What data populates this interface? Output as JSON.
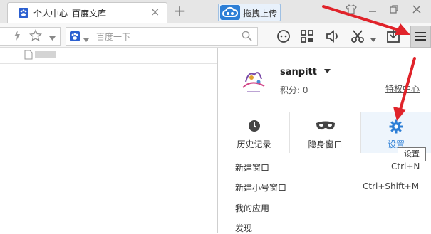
{
  "tabs": [
    {
      "title": "个人中心_百度文库",
      "close_label": "×",
      "favicon": "paw-icon"
    }
  ],
  "new_tab_label": "+",
  "toolbar": {
    "upload_label": "拖拽上传",
    "search_placeholder": "百度一下"
  },
  "menu": {
    "username": "sanpitt",
    "points": "积分: 0",
    "vip_link": "特权中心",
    "tiles": [
      {
        "label": "历史记录",
        "icon": "clock-icon"
      },
      {
        "label": "隐身窗口",
        "icon": "mask-icon"
      },
      {
        "label": "设置",
        "icon": "gear-icon"
      }
    ],
    "items": [
      {
        "label": "新建窗口",
        "shortcut": "Ctrl+N"
      },
      {
        "label": "新建小号窗口",
        "shortcut": "Ctrl+Shift+M"
      },
      {
        "label": "我的应用",
        "shortcut": ""
      },
      {
        "label": "发现",
        "shortcut": ""
      }
    ],
    "tooltip": "设置"
  },
  "colors": {
    "accent": "#2d7fd6",
    "arrow": "#e0232a"
  }
}
